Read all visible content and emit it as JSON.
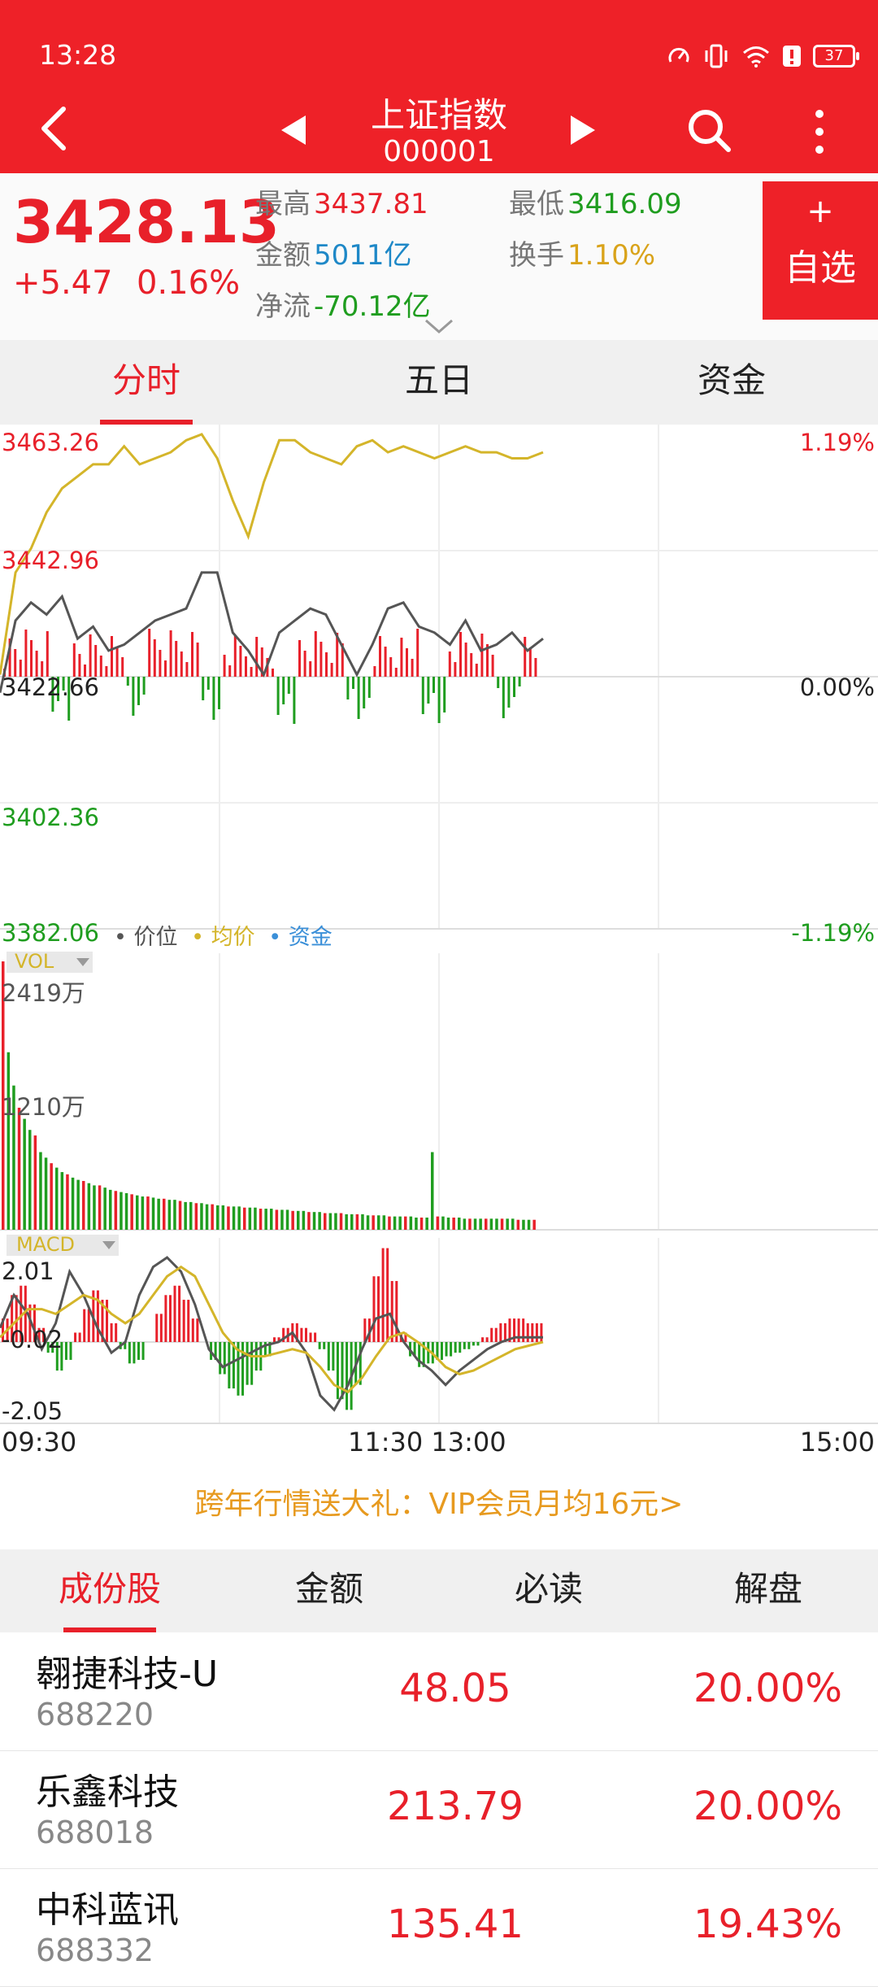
{
  "status": {
    "time": "13:28",
    "battery": "37"
  },
  "header": {
    "title": "上证指数",
    "code": "000001"
  },
  "quote": {
    "price": "3428.13",
    "change": "+5.47",
    "change_pct": "0.16%",
    "high_label": "最高",
    "high": "3437.81",
    "low_label": "最低",
    "low": "3416.09",
    "amount_label": "金额",
    "amount": "5011亿",
    "turnover_label": "换手",
    "turnover": "1.10%",
    "netflow_label": "净流",
    "netflow": "-70.12亿",
    "fav_plus": "+",
    "fav_label": "自选"
  },
  "tabs": [
    {
      "label": "分时"
    },
    {
      "label": "五日"
    },
    {
      "label": "资金"
    }
  ],
  "chart_labels": {
    "price_ticks": [
      "3463.26",
      "3442.96",
      "3422.66",
      "3402.36",
      "3382.06"
    ],
    "pct_ticks": [
      "1.19%",
      "0.00%",
      "-1.19%"
    ],
    "legend": [
      "价位",
      "均价",
      "资金"
    ],
    "vol_badge": "VOL",
    "vol_ticks": [
      "2419万",
      "1210万"
    ],
    "macd_badge": "MACD",
    "macd_ticks": [
      "2.01",
      "-0.02",
      "-2.05"
    ],
    "time_ticks": [
      "09:30",
      "11:30 13:00",
      "15:00"
    ]
  },
  "colors": {
    "up": "#e8202a",
    "down": "#1f9d1f",
    "price_line": "#555555",
    "avg_line": "#d4b52a",
    "fund": "#3a8fd8",
    "header": "#ee2128"
  },
  "chart_data": [
    {
      "type": "line",
      "title": "",
      "xlabel": "",
      "ylabel": "",
      "x_range": [
        "09:30",
        "15:00"
      ],
      "ylim": [
        3382.06,
        3463.26
      ],
      "grid": true,
      "legend_position": "bottom-left",
      "series": [
        {
          "name": "价位",
          "values": [
            3420,
            3432,
            3435,
            3433,
            3436,
            3429,
            3431,
            3427,
            3428,
            3430,
            3432,
            3433,
            3434,
            3440,
            3440,
            3430,
            3427,
            3423,
            3430,
            3432,
            3434,
            3433,
            3428,
            3423,
            3428,
            3434,
            3435,
            3431,
            3430,
            3428,
            3432,
            3427,
            3428,
            3430,
            3427,
            3429
          ]
        },
        {
          "name": "均价",
          "values": [
            3423,
            3440,
            3444,
            3450,
            3454,
            3456,
            3458,
            3458,
            3461,
            3458,
            3459,
            3460,
            3462,
            3463,
            3459,
            3452,
            3446,
            3455,
            3462,
            3462,
            3460,
            3459,
            3458,
            3461,
            3462,
            3460,
            3461,
            3460,
            3459,
            3460,
            3461,
            3460,
            3460,
            3459,
            3459,
            3460
          ]
        },
        {
          "name": "资金",
          "values": []
        }
      ]
    },
    {
      "type": "bar",
      "title": "",
      "ylabel": "VOL",
      "ylim": [
        0,
        2419
      ],
      "series": [
        {
          "name": "VOL",
          "values": [
            2419,
            1600,
            1300,
            1100,
            1000,
            900,
            850,
            700,
            650,
            600,
            560,
            520,
            500,
            470,
            450,
            440,
            420,
            400,
            400,
            380,
            360,
            350,
            340,
            330,
            320,
            310,
            300,
            300,
            290,
            280,
            280,
            270,
            270,
            260,
            250,
            250,
            240,
            240,
            230,
            230,
            220,
            220,
            210,
            210,
            210,
            200,
            200,
            200,
            190,
            190,
            190,
            180,
            180,
            180,
            170,
            170,
            170,
            160,
            160,
            160,
            150,
            150,
            150,
            150,
            140,
            140,
            140,
            140,
            130,
            130,
            130,
            130,
            120,
            120,
            120,
            120,
            120,
            110,
            110,
            110,
            700,
            120,
            120,
            110,
            110,
            110,
            100,
            100,
            100,
            100,
            100,
            100,
            100,
            100,
            100,
            100,
            90,
            90,
            90,
            90
          ]
        }
      ]
    },
    {
      "type": "bar",
      "title": "",
      "ylabel": "MACD",
      "ylim": [
        -2.05,
        2.01
      ],
      "series": [
        {
          "name": "MACD",
          "values": [
            0.5,
            1.0,
            1.2,
            0.8,
            0.3,
            -0.3,
            -0.8,
            -0.5,
            0.2,
            0.7,
            1.1,
            0.9,
            0.4,
            -0.2,
            -0.6,
            -0.5,
            0,
            0.6,
            1.0,
            1.2,
            0.9,
            0.5,
            0,
            -0.5,
            -0.9,
            -1.3,
            -1.5,
            -1.2,
            -0.8,
            -0.4,
            0.1,
            0.3,
            0.4,
            0.3,
            0.2,
            -0.2,
            -0.8,
            -1.6,
            -1.9,
            -1.2,
            0.5,
            1.4,
            2.0,
            1.3,
            0.2,
            -0.4,
            -0.7,
            -0.6,
            -0.5,
            -0.4,
            -0.3,
            -0.2,
            -0.1,
            0.1,
            0.3,
            0.4,
            0.5,
            0.5,
            0.4,
            0.4
          ]
        },
        {
          "name": "DIF",
          "values": [
            0.3,
            1.0,
            0.6,
            -0.2,
            0.4,
            1.5,
            1.0,
            0.3,
            -0.3,
            0,
            1.0,
            1.6,
            1.8,
            1.5,
            0.8,
            -0.2,
            -0.7,
            -0.5,
            -0.3,
            -0.1,
            0,
            0.2,
            -0.3,
            -1.5,
            -1.9,
            -1.2,
            -0.2,
            0.5,
            0.6,
            0,
            -0.5,
            -0.8,
            -1.2,
            -0.8,
            -0.5,
            -0.2,
            0,
            0.1,
            0.1,
            0.1
          ]
        },
        {
          "name": "DEA",
          "values": [
            0.1,
            0.4,
            0.7,
            0.7,
            0.6,
            0.8,
            1.0,
            0.9,
            0.6,
            0.4,
            0.6,
            1.0,
            1.4,
            1.6,
            1.4,
            0.8,
            0.2,
            -0.2,
            -0.4,
            -0.4,
            -0.3,
            -0.2,
            -0.3,
            -0.7,
            -1.2,
            -1.4,
            -1.0,
            -0.4,
            0.1,
            0.2,
            0,
            -0.3,
            -0.7,
            -0.9,
            -0.8,
            -0.6,
            -0.4,
            -0.2,
            -0.1,
            0
          ]
        }
      ]
    }
  ],
  "promo": "跨年行情送大礼：VIP会员月均16元>",
  "stock_tabs": [
    {
      "label": "成份股"
    },
    {
      "label": "金额"
    },
    {
      "label": "必读"
    },
    {
      "label": "解盘"
    }
  ],
  "stocks": [
    {
      "name": "翱捷科技-U",
      "code": "688220",
      "price": "48.05",
      "pct": "20.00%"
    },
    {
      "name": "乐鑫科技",
      "code": "688018",
      "price": "213.79",
      "pct": "20.00%"
    },
    {
      "name": "中科蓝讯",
      "code": "688332",
      "price": "135.41",
      "pct": "19.43%"
    }
  ]
}
